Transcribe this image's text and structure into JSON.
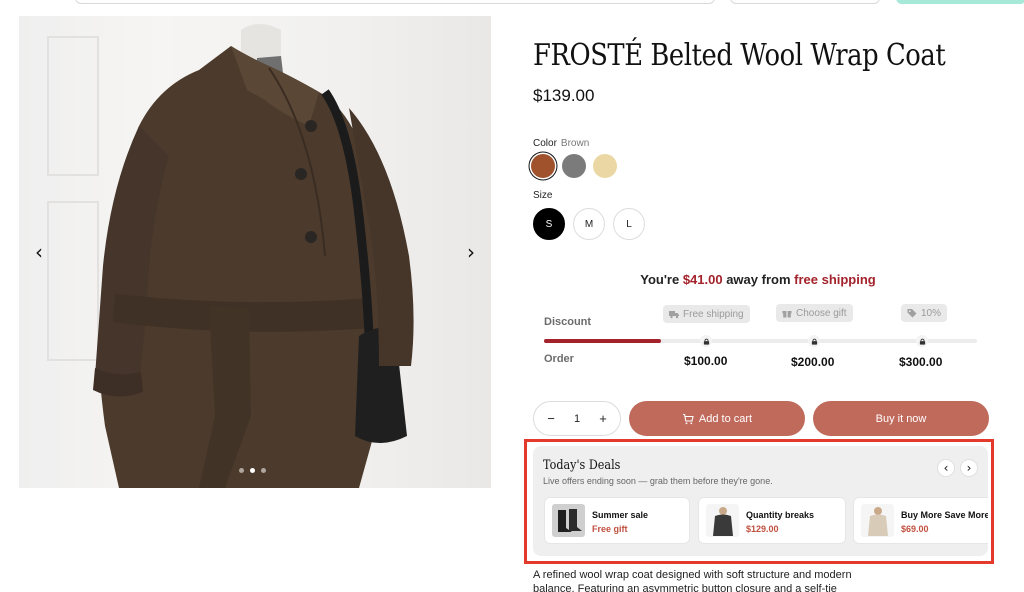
{
  "product": {
    "title": "FROSTÉ Belted Wool Wrap Coat",
    "price": "$139.00",
    "description": "A refined wool wrap coat designed with soft structure and modern balance. Featuring an asymmetric button closure and a self-tie belt, this"
  },
  "gallery": {
    "prev_icon": "chevron-left-icon",
    "next_icon": "chevron-right-icon",
    "prev_glyph": "‹",
    "next_glyph": "›",
    "slide_count": 3,
    "active_slide": 2
  },
  "color": {
    "label": "Color",
    "selected": "Brown",
    "swatches": [
      {
        "name": "Brown",
        "hex": "#a0522d"
      },
      {
        "name": "Gray",
        "hex": "#7b7b7b"
      },
      {
        "name": "Cream",
        "hex": "#ead7a3"
      }
    ]
  },
  "size": {
    "label": "Size",
    "options": [
      "S",
      "M",
      "L"
    ],
    "selected": "S"
  },
  "shipping": {
    "prefix": "You're ",
    "amount": "$41.00",
    "middle": " away from ",
    "goal": "free shipping"
  },
  "tiers": {
    "discount_label": "Discount",
    "order_label": "Order",
    "progress": 0.27,
    "items": [
      {
        "badge": "Free shipping",
        "icon": "truck-icon",
        "amount": "$100.00"
      },
      {
        "badge": "Choose gift",
        "icon": "gift-icon",
        "amount": "$200.00"
      },
      {
        "badge": "10%",
        "icon": "tag-icon",
        "amount": "$300.00"
      }
    ]
  },
  "cart": {
    "quantity": "1",
    "minus": "−",
    "plus": "+",
    "add_to_cart": "Add to cart",
    "buy_now": "Buy it now"
  },
  "deals": {
    "title": "Today's Deals",
    "subtitle": "Live offers ending soon — grab them before they're gone.",
    "prev_glyph": "‹",
    "next_glyph": "›",
    "items": [
      {
        "name": "Summer sale",
        "value": "Free gift"
      },
      {
        "name": "Quantity breaks",
        "value": "$129.00"
      },
      {
        "name": "Buy More Save More",
        "value": "$69.00"
      }
    ]
  },
  "colors": {
    "accent": "#c06a5c",
    "progress_red": "#a3222b",
    "highlight_outline": "#e33a2b"
  }
}
